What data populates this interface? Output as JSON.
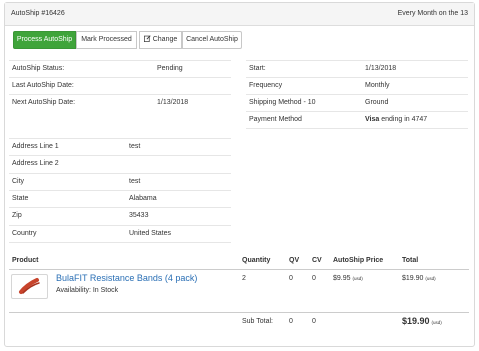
{
  "header": {
    "title": "AutoShip #16426",
    "schedule": "Every Month on the 13"
  },
  "toolbar": {
    "process_label": "Process AutoShip",
    "mark_processed_label": "Mark Processed",
    "change_label": "Change",
    "cancel_label": "Cancel AutoShip"
  },
  "colors": {
    "primary_button": "#3fa43a",
    "link": "#2a6fb5",
    "product_image": "#c8442c"
  },
  "status_left": [
    {
      "label": "AutoShip Status:",
      "value": "Pending"
    },
    {
      "label": "Last AutoShip Date:",
      "value": ""
    },
    {
      "label": "Next AutoShip Date:",
      "value": "1/13/2018"
    }
  ],
  "status_right": [
    {
      "label": "Start:",
      "value": "1/13/2018"
    },
    {
      "label": "Frequency",
      "value": "Monthly"
    },
    {
      "label": "Shipping Method - 10",
      "value": "Ground"
    },
    {
      "label": "Payment Method",
      "value_bold": "Visa",
      "value": " ending in 4747"
    }
  ],
  "address": [
    {
      "label": "Address Line 1",
      "value": "test"
    },
    {
      "label": "Address Line 2",
      "value": ""
    },
    {
      "label": "City",
      "value": "test"
    },
    {
      "label": "State",
      "value": "Alabama"
    },
    {
      "label": "Zip",
      "value": "35433"
    },
    {
      "label": "Country",
      "value": "United States"
    }
  ],
  "items_table": {
    "headers": [
      "Product",
      "Quantity",
      "QV",
      "CV",
      "AutoShip Price",
      "Total"
    ],
    "rows": [
      {
        "product_name": "BulaFIT Resistance Bands (4 pack)",
        "availability": "Availability: In Stock",
        "image_icon": "resistance-band-image",
        "quantity": "2",
        "qv": "0",
        "cv": "0",
        "price": "$9.95",
        "price_currency": "(usd)",
        "total": "$19.90",
        "total_currency": "(usd)"
      }
    ],
    "subtotal": {
      "label": "Sub Total:",
      "qv": "0",
      "cv": "0",
      "total": "$19.90",
      "currency": "(usd)"
    }
  }
}
